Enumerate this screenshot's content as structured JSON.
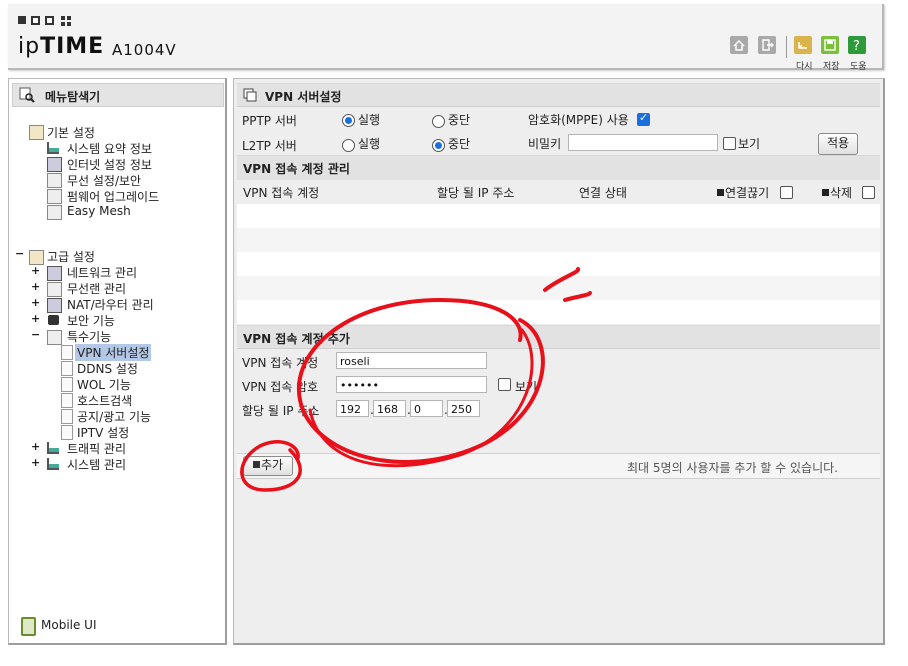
{
  "header": {
    "logo_prefix": "ip",
    "logo_strong": "TIME",
    "model": "A1004V",
    "actions": [
      {
        "label": "다시",
        "icon": "reload-icon"
      },
      {
        "label": "저장",
        "icon": "save-icon"
      },
      {
        "label": "도움",
        "icon": "help-icon"
      }
    ]
  },
  "left": {
    "title": "메뉴탐색기",
    "basic": {
      "label": "기본 설정",
      "items": [
        "시스템 요약 정보",
        "인터넷 설정 정보",
        "무선 설정/보안",
        "펌웨어 업그레이드",
        "Easy Mesh"
      ]
    },
    "advanced": {
      "label": "고급 설정",
      "groups": [
        "네트워크 관리",
        "무선랜 관리",
        "NAT/라우터 관리",
        "보안 기능",
        "특수기능"
      ],
      "special_items": [
        "VPN 서버설정",
        "DDNS 설정",
        "WOL 기능",
        "호스트검색",
        "공지/광고 기능",
        "IPTV 설정"
      ],
      "after_groups": [
        "트래픽 관리",
        "시스템 관리"
      ]
    },
    "mobile_label": "Mobile UI"
  },
  "main": {
    "title": "VPN 서버설정",
    "pptp_label": "PPTP 서버",
    "l2tp_label": "L2TP 서버",
    "run_label": "실행",
    "stop_label": "중단",
    "mppe_label": "암호화(MPPE) 사용",
    "password_label": "비밀키",
    "show_label": "보기",
    "apply_button": "적용",
    "accounts_title": "VPN 접속 계정 관리",
    "columns": {
      "account": "VPN 접속 계정",
      "ip": "할당 될 IP 주소",
      "status": "연결 상태",
      "disconnect": "연결끊기",
      "delete": "삭제"
    },
    "add_title": "VPN 접속 계정 추가",
    "account_label": "VPN 접속 계정",
    "account_value": "roseli",
    "pw_label": "VPN 접속 암호",
    "pw_value": "••••••",
    "pw_show_label": "보기",
    "ip_label": "할당 될 IP 주소",
    "ip_octets": [
      "192",
      "168",
      "0",
      "250"
    ],
    "add_button": "추가",
    "hint": "최대 5명의 사용자를 추가 할 수 있습니다."
  },
  "colors": {
    "accent": "#1a6fe0",
    "annotation": "#e8101a"
  }
}
